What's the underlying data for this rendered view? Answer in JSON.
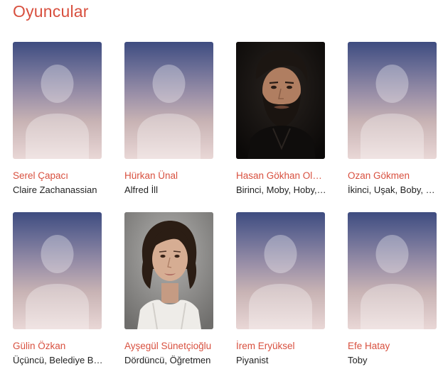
{
  "section": {
    "title": "Oyuncular",
    "title_color": "#d8503f"
  },
  "cast": [
    {
      "name": "Serel Çapacı",
      "role": "Claire Zachanassian",
      "photo": "placeholder"
    },
    {
      "name": "Hürkan Ünal",
      "role": "Alfred İll",
      "photo": "placeholder"
    },
    {
      "name": "Hasan Gökhan Olcay",
      "role": "Birinci, Moby, Hoby, Koby",
      "photo": "bearded-man-portrait"
    },
    {
      "name": "Ozan Gökmen",
      "role": "İkinci, Uşak, Boby, Loby",
      "photo": "placeholder"
    },
    {
      "name": "Gülin Özkan",
      "role": "Üçüncü, Belediye Başkanı",
      "photo": "placeholder"
    },
    {
      "name": "Ayşegül Sünetçioğlu",
      "role": "Dördüncü, Öğretmen",
      "photo": "woman-portrait"
    },
    {
      "name": "İrem Eryüksel",
      "role": "Piyanist",
      "photo": "placeholder"
    },
    {
      "name": "Efe Hatay",
      "role": "Toby",
      "photo": "placeholder"
    }
  ]
}
